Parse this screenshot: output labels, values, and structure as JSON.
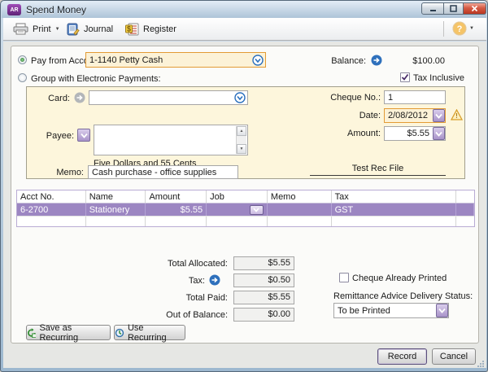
{
  "window": {
    "title": "Spend Money",
    "app_badge": "AR"
  },
  "toolbar": {
    "print_label": "Print",
    "journal_label": "Journal",
    "register_label": "Register"
  },
  "account_row": {
    "pay_from_label": "Pay from Account:",
    "account_value": "1-1140 Petty Cash",
    "group_label": "Group with Electronic Payments:",
    "balance_label": "Balance:",
    "balance_value": "$100.00",
    "tax_inclusive_label": "Tax Inclusive"
  },
  "form": {
    "card_label": "Card:",
    "card_value": "",
    "cheque_no_label": "Cheque No.:",
    "cheque_no_value": "1",
    "date_label": "Date:",
    "date_value": "2/08/2012",
    "amount_label": "Amount:",
    "amount_value": "$5.55",
    "payee_label": "Payee:",
    "payee_value": "",
    "amount_in_words": "Five Dollars and 55 Cents",
    "memo_label": "Memo:",
    "memo_value": "Cash purchase - office supplies",
    "rec_file_label": "Test Rec File"
  },
  "table": {
    "columns": [
      "Acct No.",
      "Name",
      "Amount",
      "Job",
      "Memo",
      "Tax"
    ],
    "rows": [
      {
        "acct_no": "6-2700",
        "name": "Stationery",
        "amount": "$5.55",
        "job": "",
        "memo": "",
        "tax": "GST"
      }
    ]
  },
  "totals": {
    "total_allocated_label": "Total Allocated:",
    "total_allocated_value": "$5.55",
    "tax_label": "Tax:",
    "tax_value": "$0.50",
    "total_paid_label": "Total Paid:",
    "total_paid_value": "$5.55",
    "out_of_balance_label": "Out of Balance:",
    "out_of_balance_value": "$0.00"
  },
  "options": {
    "cheque_printed_label": "Cheque Already Printed",
    "remittance_label": "Remittance Advice Delivery Status:",
    "remittance_value": "To be Printed"
  },
  "actions": {
    "save_recurring_label": "Save as Recurring",
    "use_recurring_label": "Use Recurring",
    "record_label": "Record",
    "cancel_label": "Cancel"
  },
  "colors": {
    "selected_row": "#9c86c2",
    "form_cream": "#fdf6dc",
    "focus_border": "#e39b35",
    "accent_blue": "#2e70bc",
    "title_purple": "#7b2d8e"
  }
}
